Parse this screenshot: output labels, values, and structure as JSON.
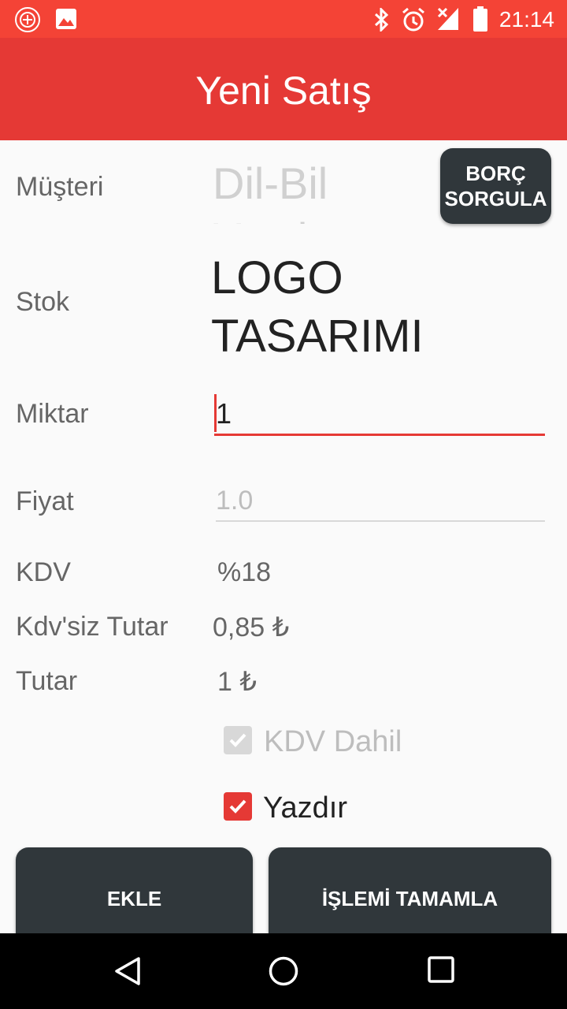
{
  "status_bar": {
    "time": "21:14",
    "icons": [
      "app-notification-icon",
      "image-notification-icon",
      "bluetooth-icon",
      "alarm-icon",
      "signal-icon",
      "battery-icon"
    ]
  },
  "app_bar": {
    "title": "Yeni Satış"
  },
  "form": {
    "customer_label": "Müşteri",
    "customer_value": "Dil-Bil Yazılım Tasarım",
    "debt_button": "BORÇ SORGULA",
    "stock_label": "Stok",
    "stock_value": "LOGO TASARIMI",
    "quantity_label": "Miktar",
    "quantity_value": "1",
    "price_label": "Fiyat",
    "price_placeholder": "1.0",
    "vat_label": "KDV",
    "vat_value": "%18",
    "net_label": "Kdv'siz Tutar",
    "net_value": "0,85 ₺",
    "total_label": "Tutar",
    "total_value": "1 ₺",
    "vat_included_label": "KDV Dahil",
    "print_label": "Yazdır"
  },
  "actions": {
    "add_label": "EKLE",
    "complete_label": "İŞLEMİ TAMAMLA"
  },
  "colors": {
    "status_bar": "#f44336",
    "app_bar": "#e53935",
    "accent": "#e53935",
    "dark_button": "#30373b"
  }
}
